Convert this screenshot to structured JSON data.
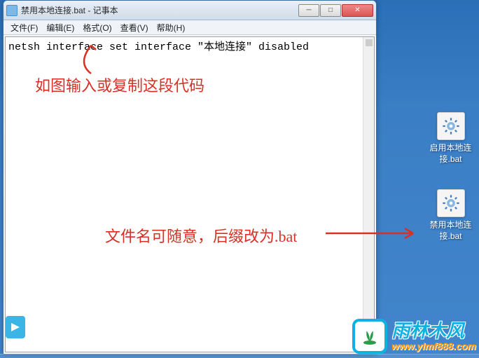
{
  "window": {
    "title": "禁用本地连接.bat - 记事本",
    "textContent": "netsh interface set interface \"本地连接\" disabled"
  },
  "menu": {
    "file": "文件(F)",
    "edit": "编辑(E)",
    "format": "格式(O)",
    "view": "查看(V)",
    "help": "帮助(H)"
  },
  "winButtons": {
    "minimize": "─",
    "maximize": "□",
    "close": "✕"
  },
  "desktopIcons": {
    "enable": {
      "label": "启用本地连接.bat"
    },
    "disable": {
      "label": "禁用本地连接.bat"
    }
  },
  "annotations": {
    "instruction1": "如图输入或复制这段代码",
    "instruction2": "文件名可随意，后缀改为.bat"
  },
  "watermark": {
    "brand": "雨林木风",
    "url": "www.ylmf888.com"
  }
}
